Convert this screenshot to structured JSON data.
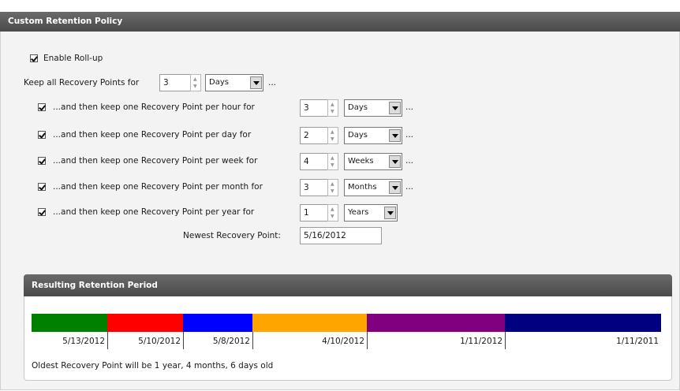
{
  "panel_title": "Custom Retention Policy",
  "enable_rollup": {
    "label": "Enable Roll-up",
    "checked": true
  },
  "keep_all": {
    "label": "Keep all Recovery Points for",
    "value": "3",
    "unit": "Days",
    "suffix": "..."
  },
  "rules": [
    {
      "label": "...and then keep one Recovery Point per hour for",
      "value": "3",
      "unit": "Days",
      "suffix": "...",
      "checked": true
    },
    {
      "label": "...and then keep one Recovery Point per day for",
      "value": "2",
      "unit": "Days",
      "suffix": "...",
      "checked": true
    },
    {
      "label": "...and then keep one Recovery Point per week for",
      "value": "4",
      "unit": "Weeks",
      "suffix": "...",
      "checked": true
    },
    {
      "label": "...and then keep one Recovery Point per month for",
      "value": "3",
      "unit": "Months",
      "suffix": "...",
      "checked": true
    },
    {
      "label": "...and then keep one Recovery Point per year for",
      "value": "1",
      "unit": "Years",
      "suffix": "",
      "checked": true
    }
  ],
  "newest": {
    "label": "Newest Recovery Point:",
    "value": "5/16/2012"
  },
  "result": {
    "title": "Resulting Retention Period",
    "segments": [
      {
        "color": "#008000",
        "date": "5/13/2012"
      },
      {
        "color": "#ff0000",
        "date": "5/10/2012"
      },
      {
        "color": "#0000ff",
        "date": "5/8/2012"
      },
      {
        "color": "#ffa500",
        "date": "4/10/2012"
      },
      {
        "color": "#800080",
        "date": "1/11/2012"
      },
      {
        "color": "#000080",
        "date": "1/11/2011"
      }
    ],
    "oldest_text": "Oldest Recovery Point will be 1 year, 4 months, 6 days old"
  }
}
